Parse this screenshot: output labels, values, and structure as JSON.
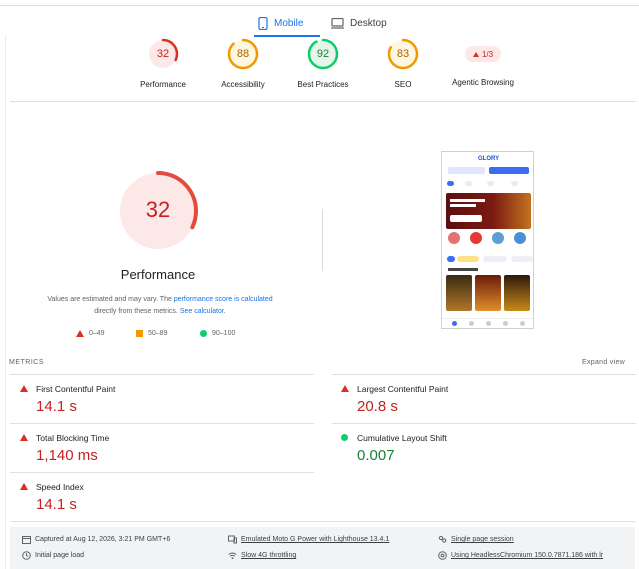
{
  "tabs": [
    {
      "label": "Mobile",
      "icon": "mobile-icon",
      "active": true
    },
    {
      "label": "Desktop",
      "icon": "desktop-icon",
      "active": false
    }
  ],
  "scores": [
    {
      "value": "32",
      "label": "Performance",
      "color": "#d93025",
      "fraction": 0.32
    },
    {
      "value": "88",
      "label": "Accessibility",
      "color": "#f29900",
      "fraction": 0.88
    },
    {
      "value": "92",
      "label": "Best Practices",
      "color": "#0cce6b",
      "fraction": 0.92
    },
    {
      "value": "83",
      "label": "SEO",
      "color": "#f29900",
      "fraction": 0.83
    }
  ],
  "agentic": {
    "value": "1/3",
    "label": "Agentic Browsing"
  },
  "performance": {
    "score": "32",
    "fraction": 0.32,
    "title": "Performance",
    "note_pre": "Values are estimated and may vary. The ",
    "note_link1": "performance score is calculated",
    "note_mid": " directly from these metrics. ",
    "note_link2": "See calculator."
  },
  "legend": [
    {
      "label": "0–49",
      "shape": "triangle",
      "color": "#d93025"
    },
    {
      "label": "50–89",
      "shape": "square",
      "color": "#f29900"
    },
    {
      "label": "90–100",
      "shape": "circle",
      "color": "#0cce6b"
    }
  ],
  "metrics": {
    "heading": "METRICS",
    "expand_label": "Expand view",
    "items": [
      {
        "name": "First Contentful Paint",
        "value": "14.1 s",
        "status": "fail"
      },
      {
        "name": "Largest Contentful Paint",
        "value": "20.8 s",
        "status": "fail"
      },
      {
        "name": "Total Blocking Time",
        "value": "1,140 ms",
        "status": "fail"
      },
      {
        "name": "Cumulative Layout Shift",
        "value": "0.007",
        "status": "pass"
      },
      {
        "name": "Speed Index",
        "value": "14.1 s",
        "status": "fail"
      }
    ]
  },
  "footer": {
    "captured": "Captured at Aug 12, 2026, 3:21 PM GMT+6",
    "load": "Initial page load",
    "device": "Emulated Moto G Power with Lighthouse 13.4.1",
    "throttling": "Slow 4G throttling",
    "session": "Single page session",
    "browser": "Using HeadlessChromium 150.0.7871.186 with lr"
  },
  "phone_preview": {
    "logo": "GLORY"
  },
  "colors": {
    "accent": "#1a73e8",
    "fail": "#c5221f",
    "average": "#f29900",
    "pass": "#0cce6b"
  }
}
